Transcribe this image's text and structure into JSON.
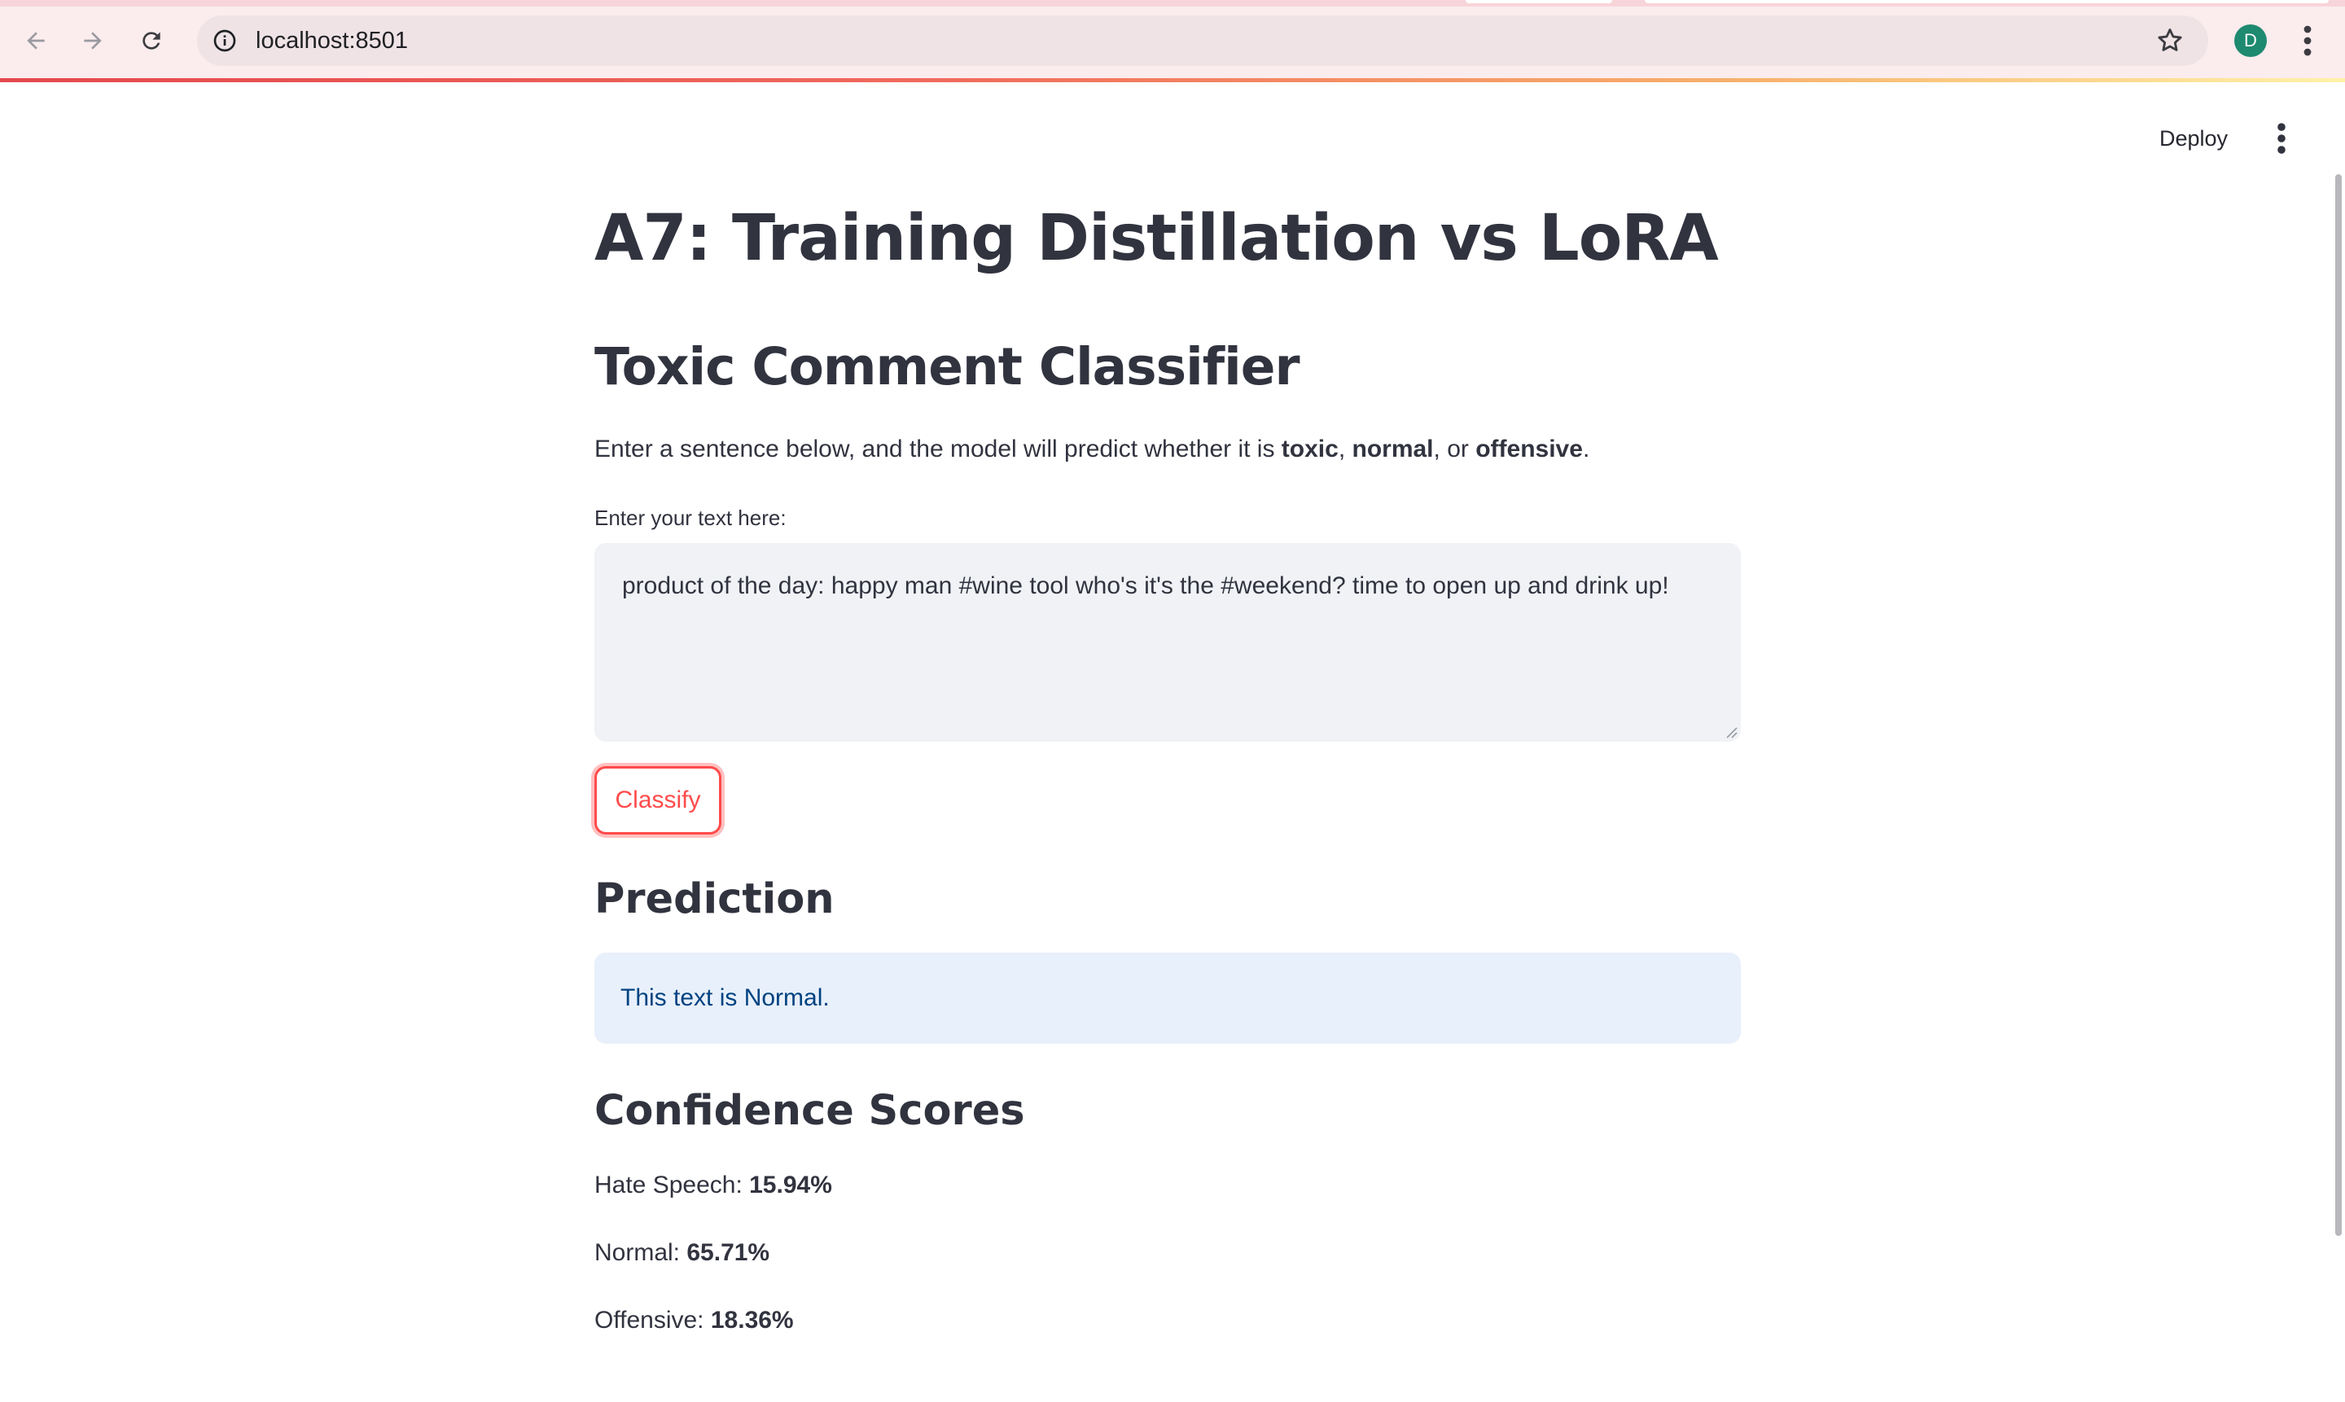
{
  "browser": {
    "url": "localhost:8501",
    "profile_initial": "D",
    "icons": {
      "back": "arrow-left-icon",
      "forward": "arrow-right-icon",
      "reload": "reload-icon",
      "site_info": "info-icon",
      "bookmark": "star-icon",
      "menu": "kebab-menu-icon"
    }
  },
  "toolbar": {
    "deploy_label": "Deploy",
    "menu_icon": "kebab-menu-icon"
  },
  "page": {
    "title": "A7: Training Distillation vs LoRA",
    "subtitle": "Toxic Comment Classifier",
    "description": {
      "prefix": "Enter a sentence below, and the model will predict whether it is ",
      "toxic": "toxic",
      "sep1": ", ",
      "normal": "normal",
      "sep2": ", or ",
      "offensive": "offensive",
      "suffix": "."
    },
    "input": {
      "label": "Enter your text here:",
      "value": "product of the day: happy man #wine tool who's it's the #weekend? time to open up and drink up!"
    },
    "classify_label": "Classify",
    "prediction": {
      "heading": "Prediction",
      "result": "This text is Normal."
    },
    "confidence": {
      "heading": "Confidence Scores",
      "scores": [
        {
          "label": "Hate Speech: ",
          "value": "15.94%"
        },
        {
          "label": "Normal: ",
          "value": "65.71%"
        },
        {
          "label": "Offensive: ",
          "value": "18.36%"
        }
      ]
    }
  },
  "colors": {
    "accent": "#ff4b4b",
    "text": "#31333f",
    "info_bg": "#e8f0fb",
    "info_text": "#004280",
    "input_bg": "#f0f2f6",
    "chrome_bg": "#fbecee",
    "avatar": "#1e8a70"
  }
}
